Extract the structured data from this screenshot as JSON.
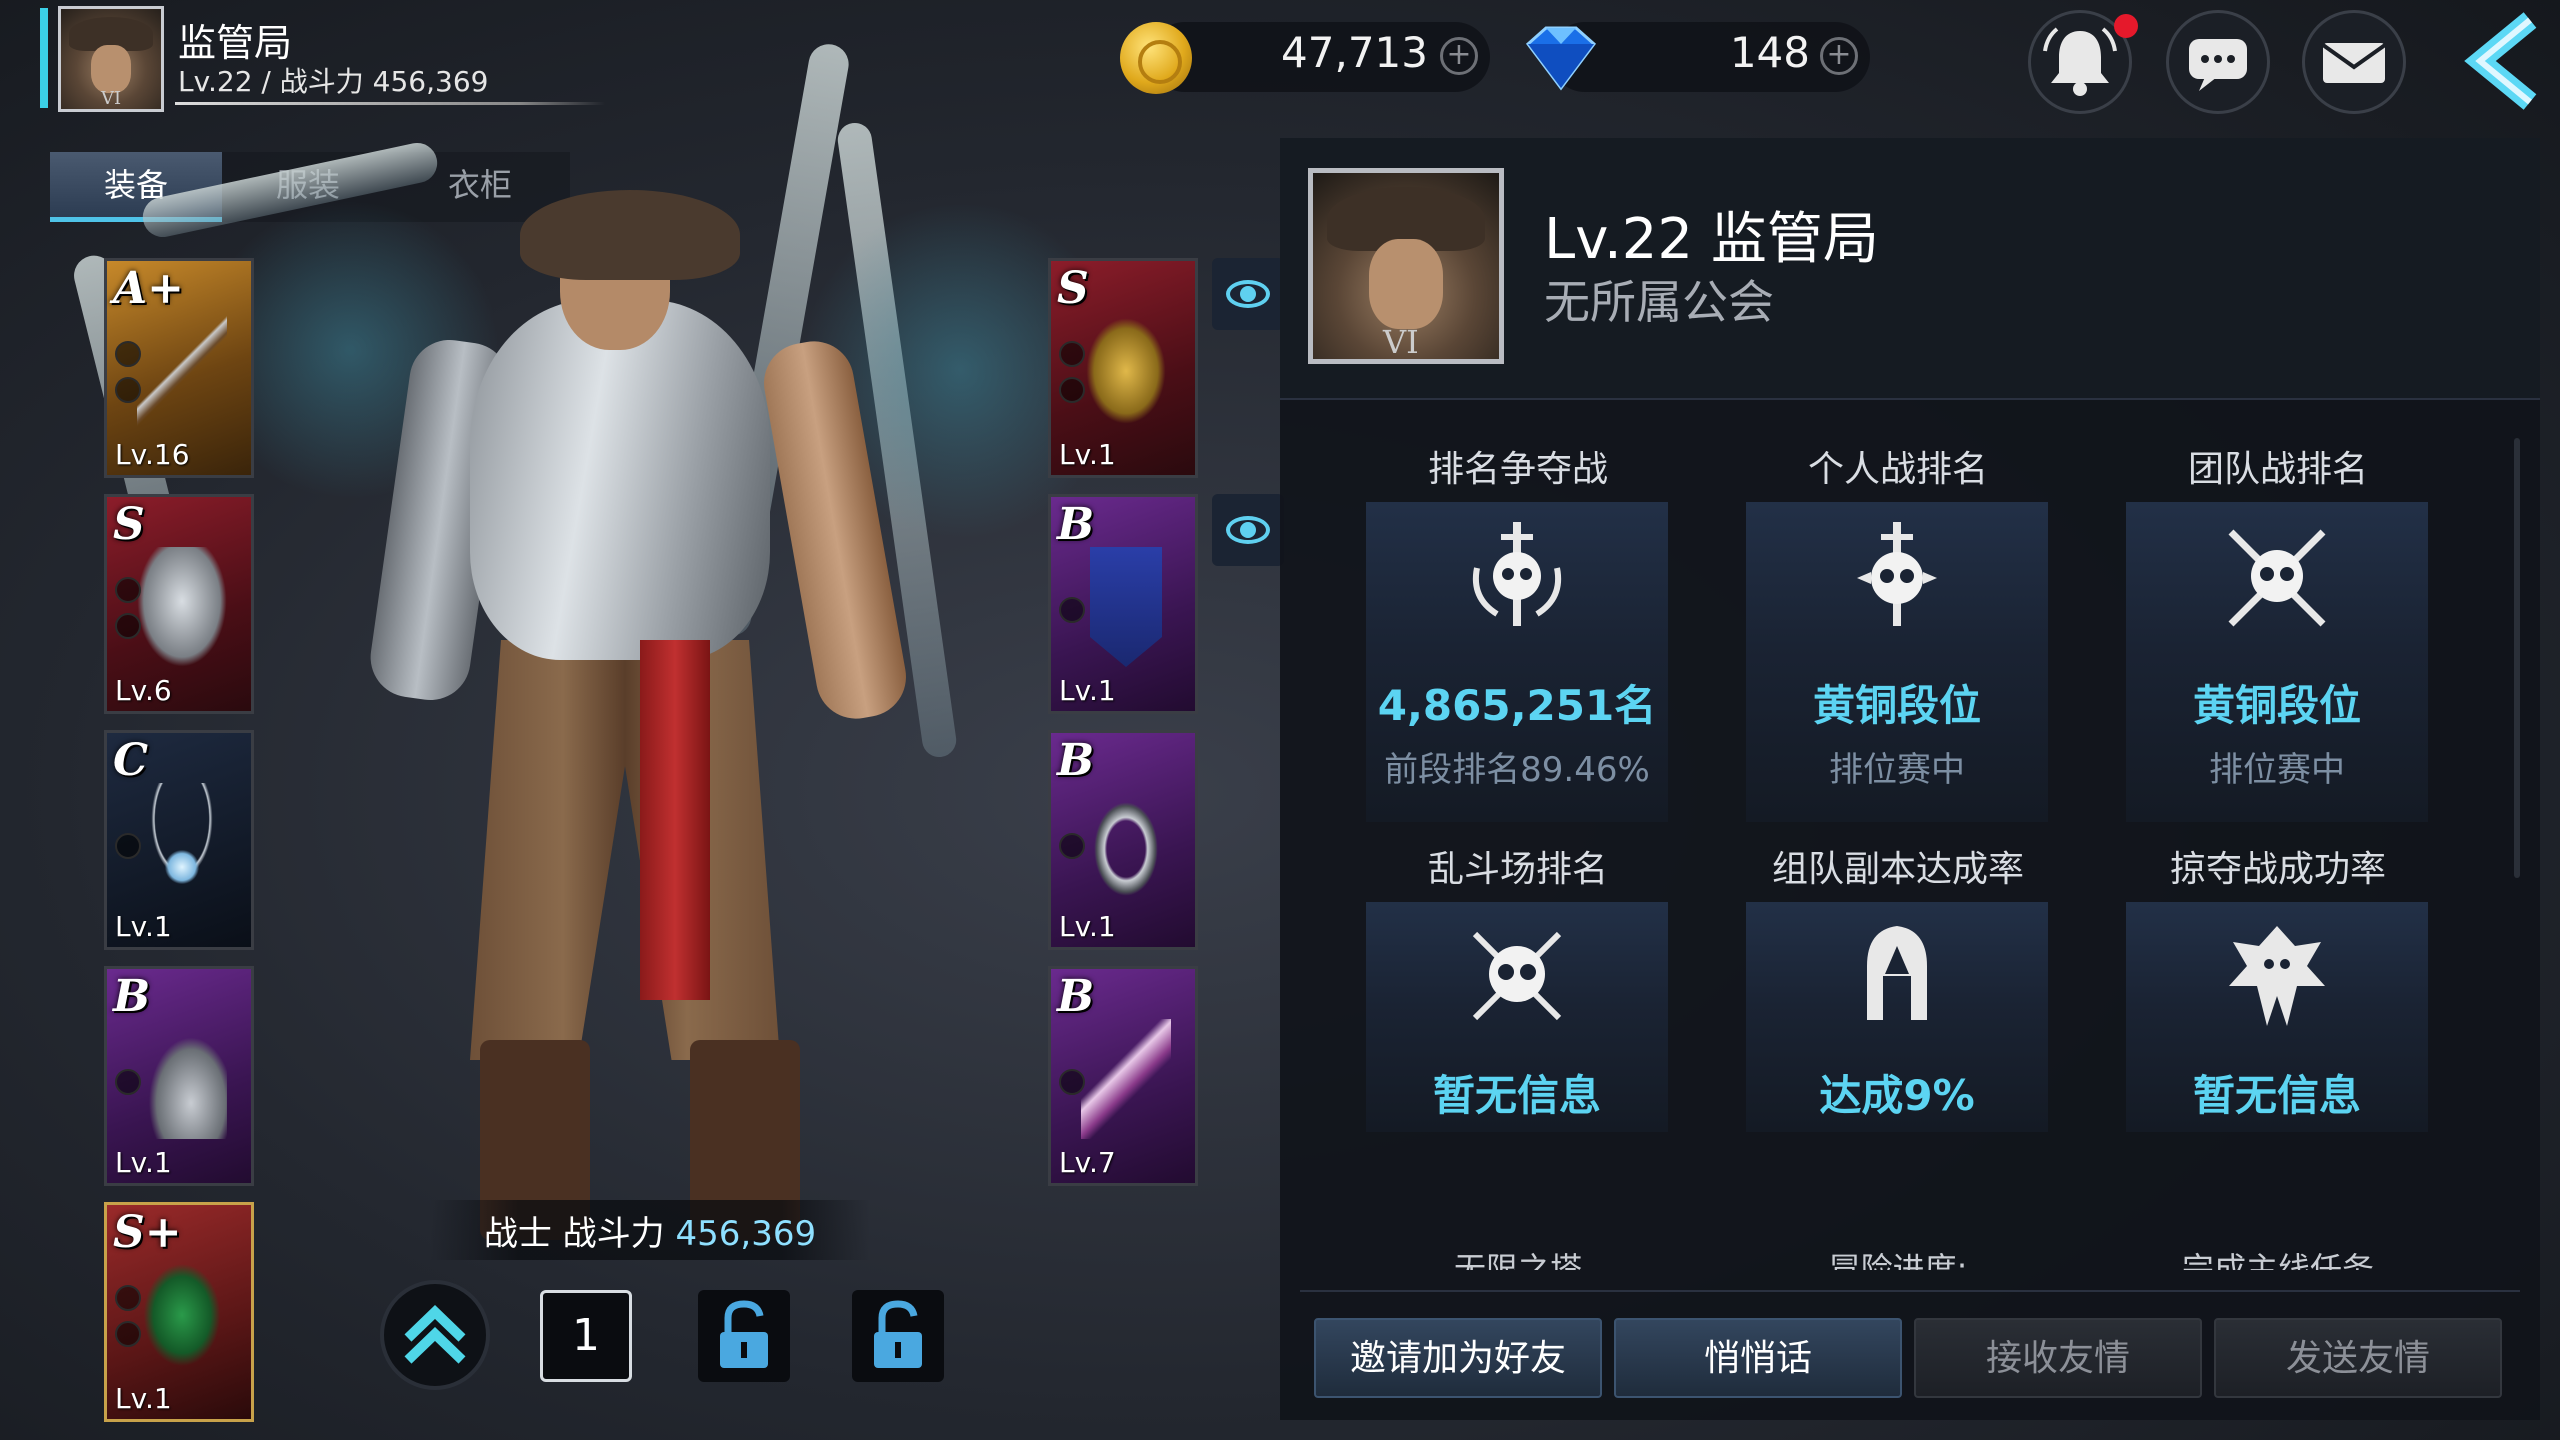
{
  "player": {
    "name": "监管局",
    "level_power": "Lv.22 / 战斗力 456,369",
    "tier_badge": "VI"
  },
  "currency": {
    "gold": "47,713",
    "gems": "148",
    "plus": "+"
  },
  "tabs": [
    {
      "label": "装备",
      "active": true
    },
    {
      "label": "服装",
      "active": false
    },
    {
      "label": "衣柜",
      "active": false
    }
  ],
  "left_slots": [
    {
      "grade": "A+",
      "level": "Lv.16",
      "color": "gold"
    },
    {
      "grade": "S",
      "level": "Lv.6",
      "color": "red"
    },
    {
      "grade": "C",
      "level": "Lv.1",
      "color": "blue"
    },
    {
      "grade": "B",
      "level": "Lv.1",
      "color": "purple"
    },
    {
      "grade": "S+",
      "level": "Lv.1",
      "color": "redgold"
    }
  ],
  "right_slots": [
    {
      "grade": "S",
      "level": "Lv.1",
      "color": "red"
    },
    {
      "grade": "B",
      "level": "Lv.1",
      "color": "purple"
    },
    {
      "grade": "B",
      "level": "Lv.1",
      "color": "purple"
    },
    {
      "grade": "B",
      "level": "Lv.7",
      "color": "purple"
    }
  ],
  "class_line": {
    "cls": "战士 战斗力",
    "power": "456,369"
  },
  "bottom_controls": {
    "number": "1"
  },
  "profile": {
    "title": "Lv.22 监管局",
    "guild": "无所属公会",
    "tier_badge": "VI"
  },
  "stats_row1": [
    {
      "title": "排名争夺战",
      "value": "4,865,251名",
      "sub": "前段排名89.46%",
      "icon": "skull-sword-laurel-icon"
    },
    {
      "title": "个人战排名",
      "value": "黄铜段位",
      "sub": "排位赛中",
      "icon": "skull-sword-icon"
    },
    {
      "title": "团队战排名",
      "value": "黄铜段位",
      "sub": "排位赛中",
      "icon": "skull-crossed-swords-icon"
    }
  ],
  "stats_row2": [
    {
      "title": "乱斗场排名",
      "value": "暂无信息",
      "icon": "skull-shield-icon"
    },
    {
      "title": "组队副本达成率",
      "value": "达成9%",
      "icon": "helmet-icon"
    },
    {
      "title": "掠夺战成功率",
      "value": "暂无信息",
      "icon": "dragon-icon"
    }
  ],
  "stats_row3_titles": [
    "无限之塔",
    "冒险进度:",
    "完成主线任务"
  ],
  "actions": [
    {
      "label": "邀请加为好友",
      "enabled": true
    },
    {
      "label": "悄悄话",
      "enabled": true
    },
    {
      "label": "接收友情",
      "enabled": false
    },
    {
      "label": "发送友情",
      "enabled": false
    }
  ],
  "colors": {
    "accent": "#5cd4f2",
    "notification": "#e5192b"
  }
}
